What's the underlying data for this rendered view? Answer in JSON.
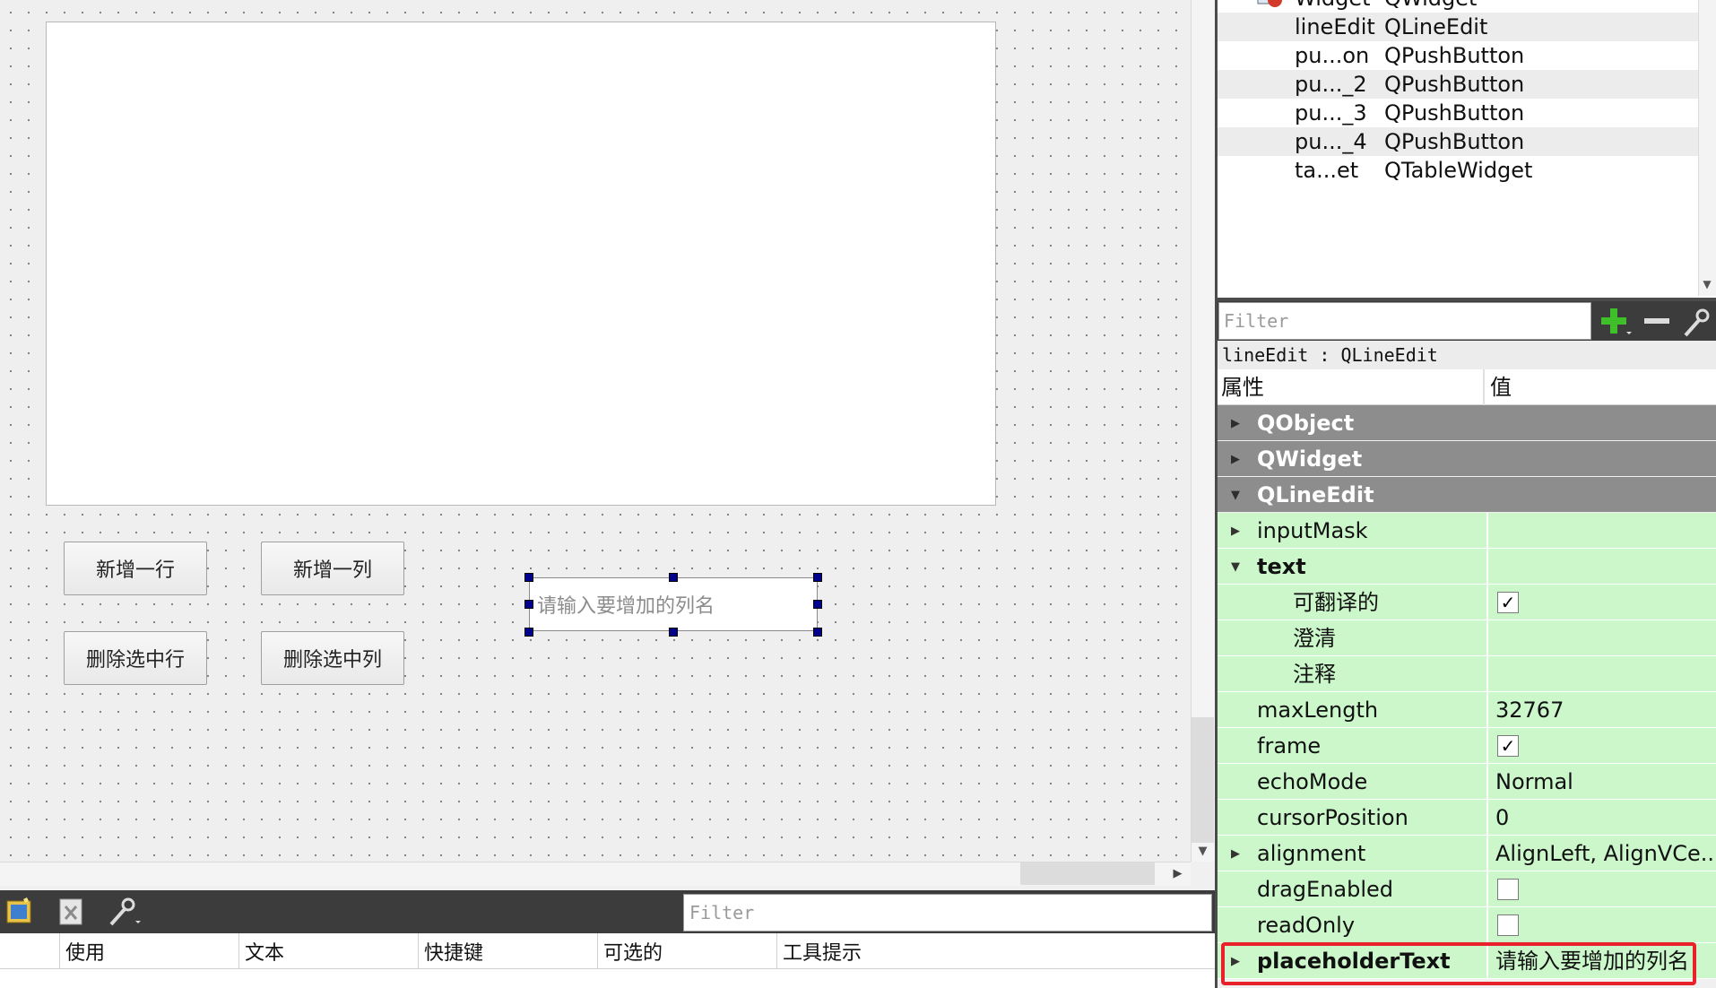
{
  "form": {
    "buttons": [
      "新增一行",
      "新增一列",
      "删除选中行",
      "删除选中列"
    ],
    "line_edit_placeholder": "请输入要增加的列名"
  },
  "object_inspector": {
    "rows": [
      {
        "name": "Widget",
        "class": "QWidget",
        "alt": false
      },
      {
        "name": "lineEdit",
        "class": "QLineEdit",
        "alt": true
      },
      {
        "name": "pu...on",
        "class": "QPushButton",
        "alt": false
      },
      {
        "name": "pu..._2",
        "class": "QPushButton",
        "alt": true
      },
      {
        "name": "pu..._3",
        "class": "QPushButton",
        "alt": false
      },
      {
        "name": "pu..._4",
        "class": "QPushButton",
        "alt": true
      },
      {
        "name": "ta...et",
        "class": "QTableWidget",
        "alt": false
      }
    ]
  },
  "property_editor": {
    "filter_placeholder": "Filter",
    "object_label": "lineEdit : QLineEdit",
    "header_property": "属性",
    "header_value": "值",
    "groups": [
      "QObject",
      "QWidget",
      "QLineEdit"
    ],
    "properties": [
      {
        "name": "inputMask",
        "value": "",
        "expandable": true
      },
      {
        "name": "text",
        "value": "",
        "expandable": true,
        "expanded": true
      },
      {
        "name": "可翻译的",
        "value": "",
        "sub": true,
        "checked": true
      },
      {
        "name": "澄清",
        "value": "",
        "sub": true
      },
      {
        "name": "注释",
        "value": "",
        "sub": true
      },
      {
        "name": "maxLength",
        "value": "32767"
      },
      {
        "name": "frame",
        "value": "",
        "checked": true
      },
      {
        "name": "echoMode",
        "value": "Normal"
      },
      {
        "name": "cursorPosition",
        "value": "0"
      },
      {
        "name": "alignment",
        "value": "AlignLeft, AlignVCe...",
        "expandable": true
      },
      {
        "name": "dragEnabled",
        "value": "",
        "checked": false
      },
      {
        "name": "readOnly",
        "value": "",
        "checked": false
      },
      {
        "name": "placeholderText",
        "value": "请输入要增加的列名",
        "expandable": true,
        "highlighted": true
      }
    ]
  },
  "action_editor": {
    "filter_placeholder": "Filter",
    "columns": [
      "使用",
      "文本",
      "快捷键",
      "可选的",
      "工具提示"
    ]
  },
  "colors": {
    "highlight": "#e8212a",
    "property_green": "#cbf7cb",
    "group_gray": "#8d8d8d",
    "handle_blue": "#00008c"
  }
}
